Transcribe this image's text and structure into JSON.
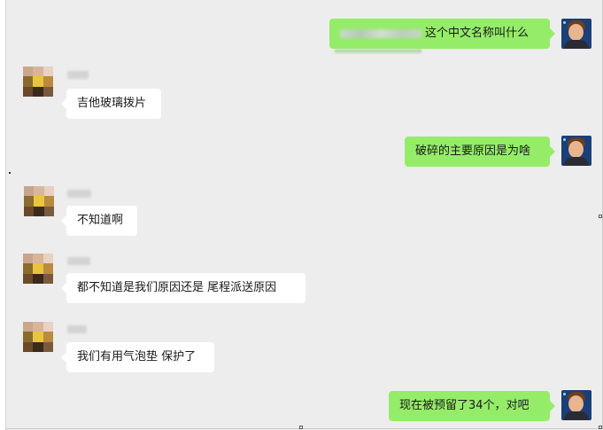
{
  "messages": [
    {
      "side": "out",
      "redacted_prefix": true,
      "text": "这个中文名称叫什么"
    },
    {
      "side": "in",
      "text": "吉他玻璃拨片"
    },
    {
      "side": "out",
      "text": "破碎的主要原因是为啥"
    },
    {
      "side": "in",
      "text": "不知道啊"
    },
    {
      "side": "in",
      "text": "都不知道是我们原因还是  尾程派送原因"
    },
    {
      "side": "in",
      "text": "我们有用气泡垫 保护了"
    },
    {
      "side": "out",
      "text": "现在被预留了34个，对吧"
    }
  ],
  "colors": {
    "background": "#ededed",
    "outgoing_bubble": "#95ec69",
    "incoming_bubble": "#ffffff"
  },
  "icons": {
    "self_avatar": "user-photo-avatar",
    "contact_avatar": "pixelated-contact-avatar"
  }
}
